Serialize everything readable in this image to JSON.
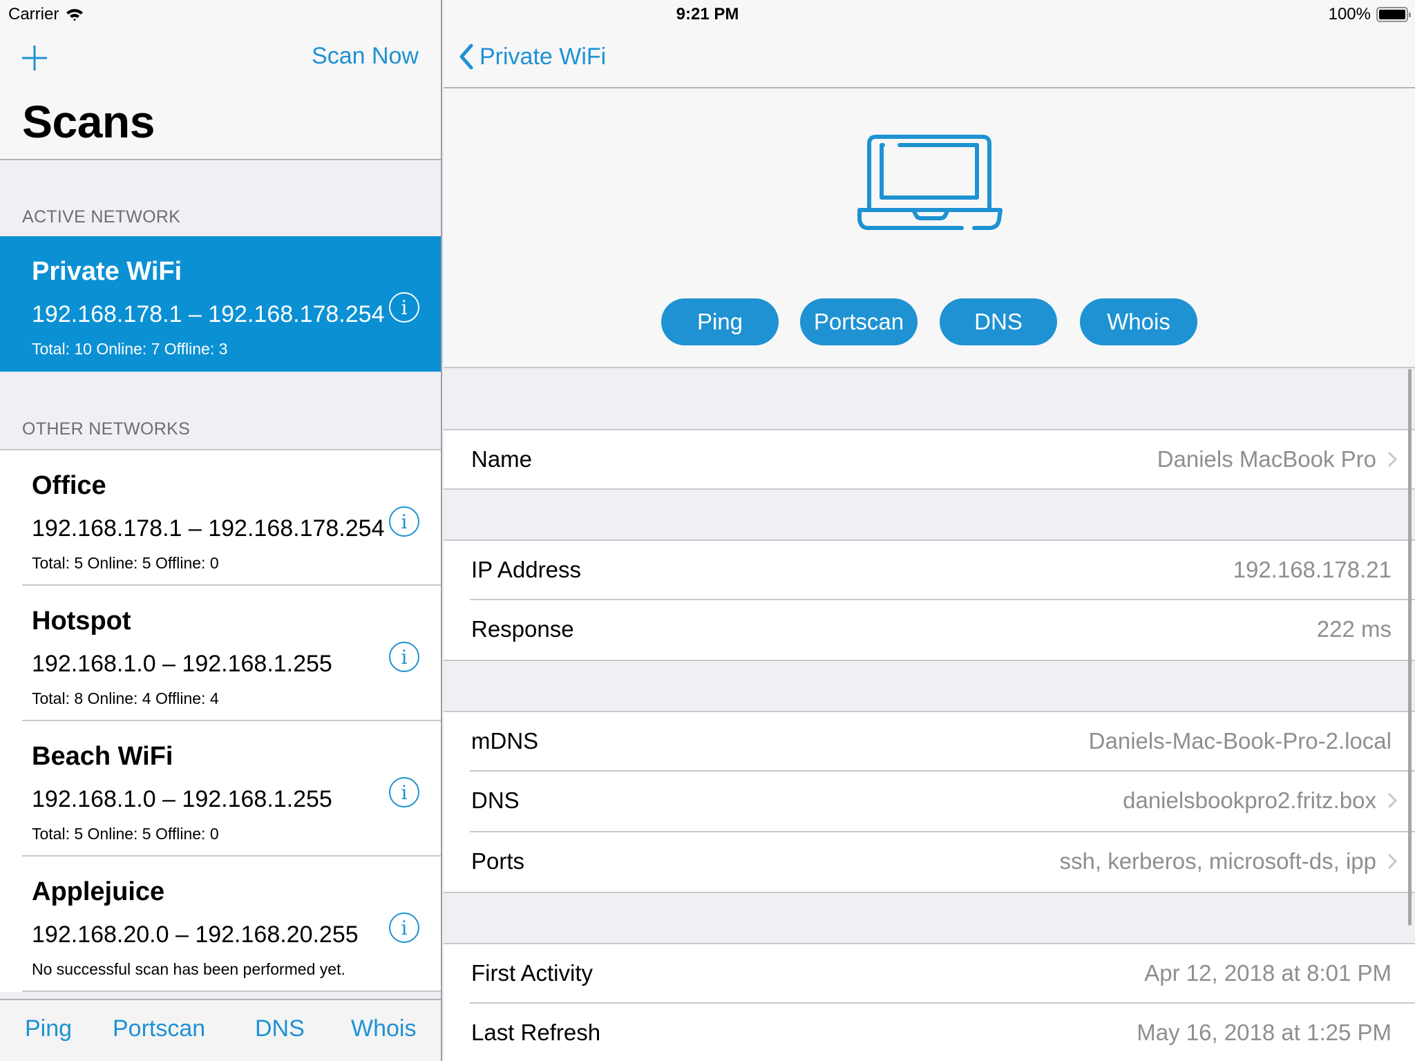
{
  "status_bar": {
    "carrier": "Carrier",
    "time": "9:21 PM",
    "battery": "100%",
    "battery_level": 1.0
  },
  "master": {
    "title": "Scans",
    "scan_now_label": "Scan Now",
    "add_icon": "plus-icon",
    "active_header": "ACTIVE NETWORK",
    "other_header": "OTHER NETWORKS",
    "active_network": {
      "name": "Private WiFi",
      "range": "192.168.178.1 – 192.168.178.254",
      "summary": "Total: 10 Online: 7 Offline: 3"
    },
    "other_networks": [
      {
        "name": "Office",
        "range": "192.168.178.1 – 192.168.178.254",
        "summary": "Total: 5 Online: 5 Offline: 0"
      },
      {
        "name": "Hotspot",
        "range": "192.168.1.0 – 192.168.1.255",
        "summary": "Total: 8 Online: 4 Offline: 4"
      },
      {
        "name": "Beach WiFi",
        "range": "192.168.1.0 – 192.168.1.255",
        "summary": "Total: 5 Online: 5 Offline: 0"
      },
      {
        "name": "Applejuice",
        "range": "192.168.20.0 – 192.168.20.255",
        "summary": "No successful scan has been performed yet."
      }
    ],
    "toolbar": [
      "Ping",
      "Portscan",
      "DNS",
      "Whois"
    ]
  },
  "detail": {
    "back_label": "Private WiFi",
    "device_icon": "laptop-icon",
    "actions": [
      "Ping",
      "Portscan",
      "DNS",
      "Whois"
    ],
    "rows": {
      "name": {
        "label": "Name",
        "value": "Daniels MacBook Pro"
      },
      "ip": {
        "label": "IP Address",
        "value": "192.168.178.21"
      },
      "response": {
        "label": "Response",
        "value": "222 ms"
      },
      "mdns": {
        "label": "mDNS",
        "value": "Daniels-Mac-Book-Pro-2.local"
      },
      "dns": {
        "label": "DNS",
        "value": "danielsbookpro2.fritz.box"
      },
      "ports": {
        "label": "Ports",
        "value": "ssh, kerberos, microsoft-ds, ipp"
      },
      "first_activity": {
        "label": "First Activity",
        "value": "Apr 12, 2018 at 8:01 PM"
      },
      "last_refresh": {
        "label": "Last Refresh",
        "value": "May 16, 2018 at 1:25 PM"
      }
    }
  },
  "colors": {
    "accent": "#1e92d2",
    "selected_cell": "#0b90d4",
    "grouped_background": "#efeff4",
    "secondary_text": "#8e8e93"
  }
}
